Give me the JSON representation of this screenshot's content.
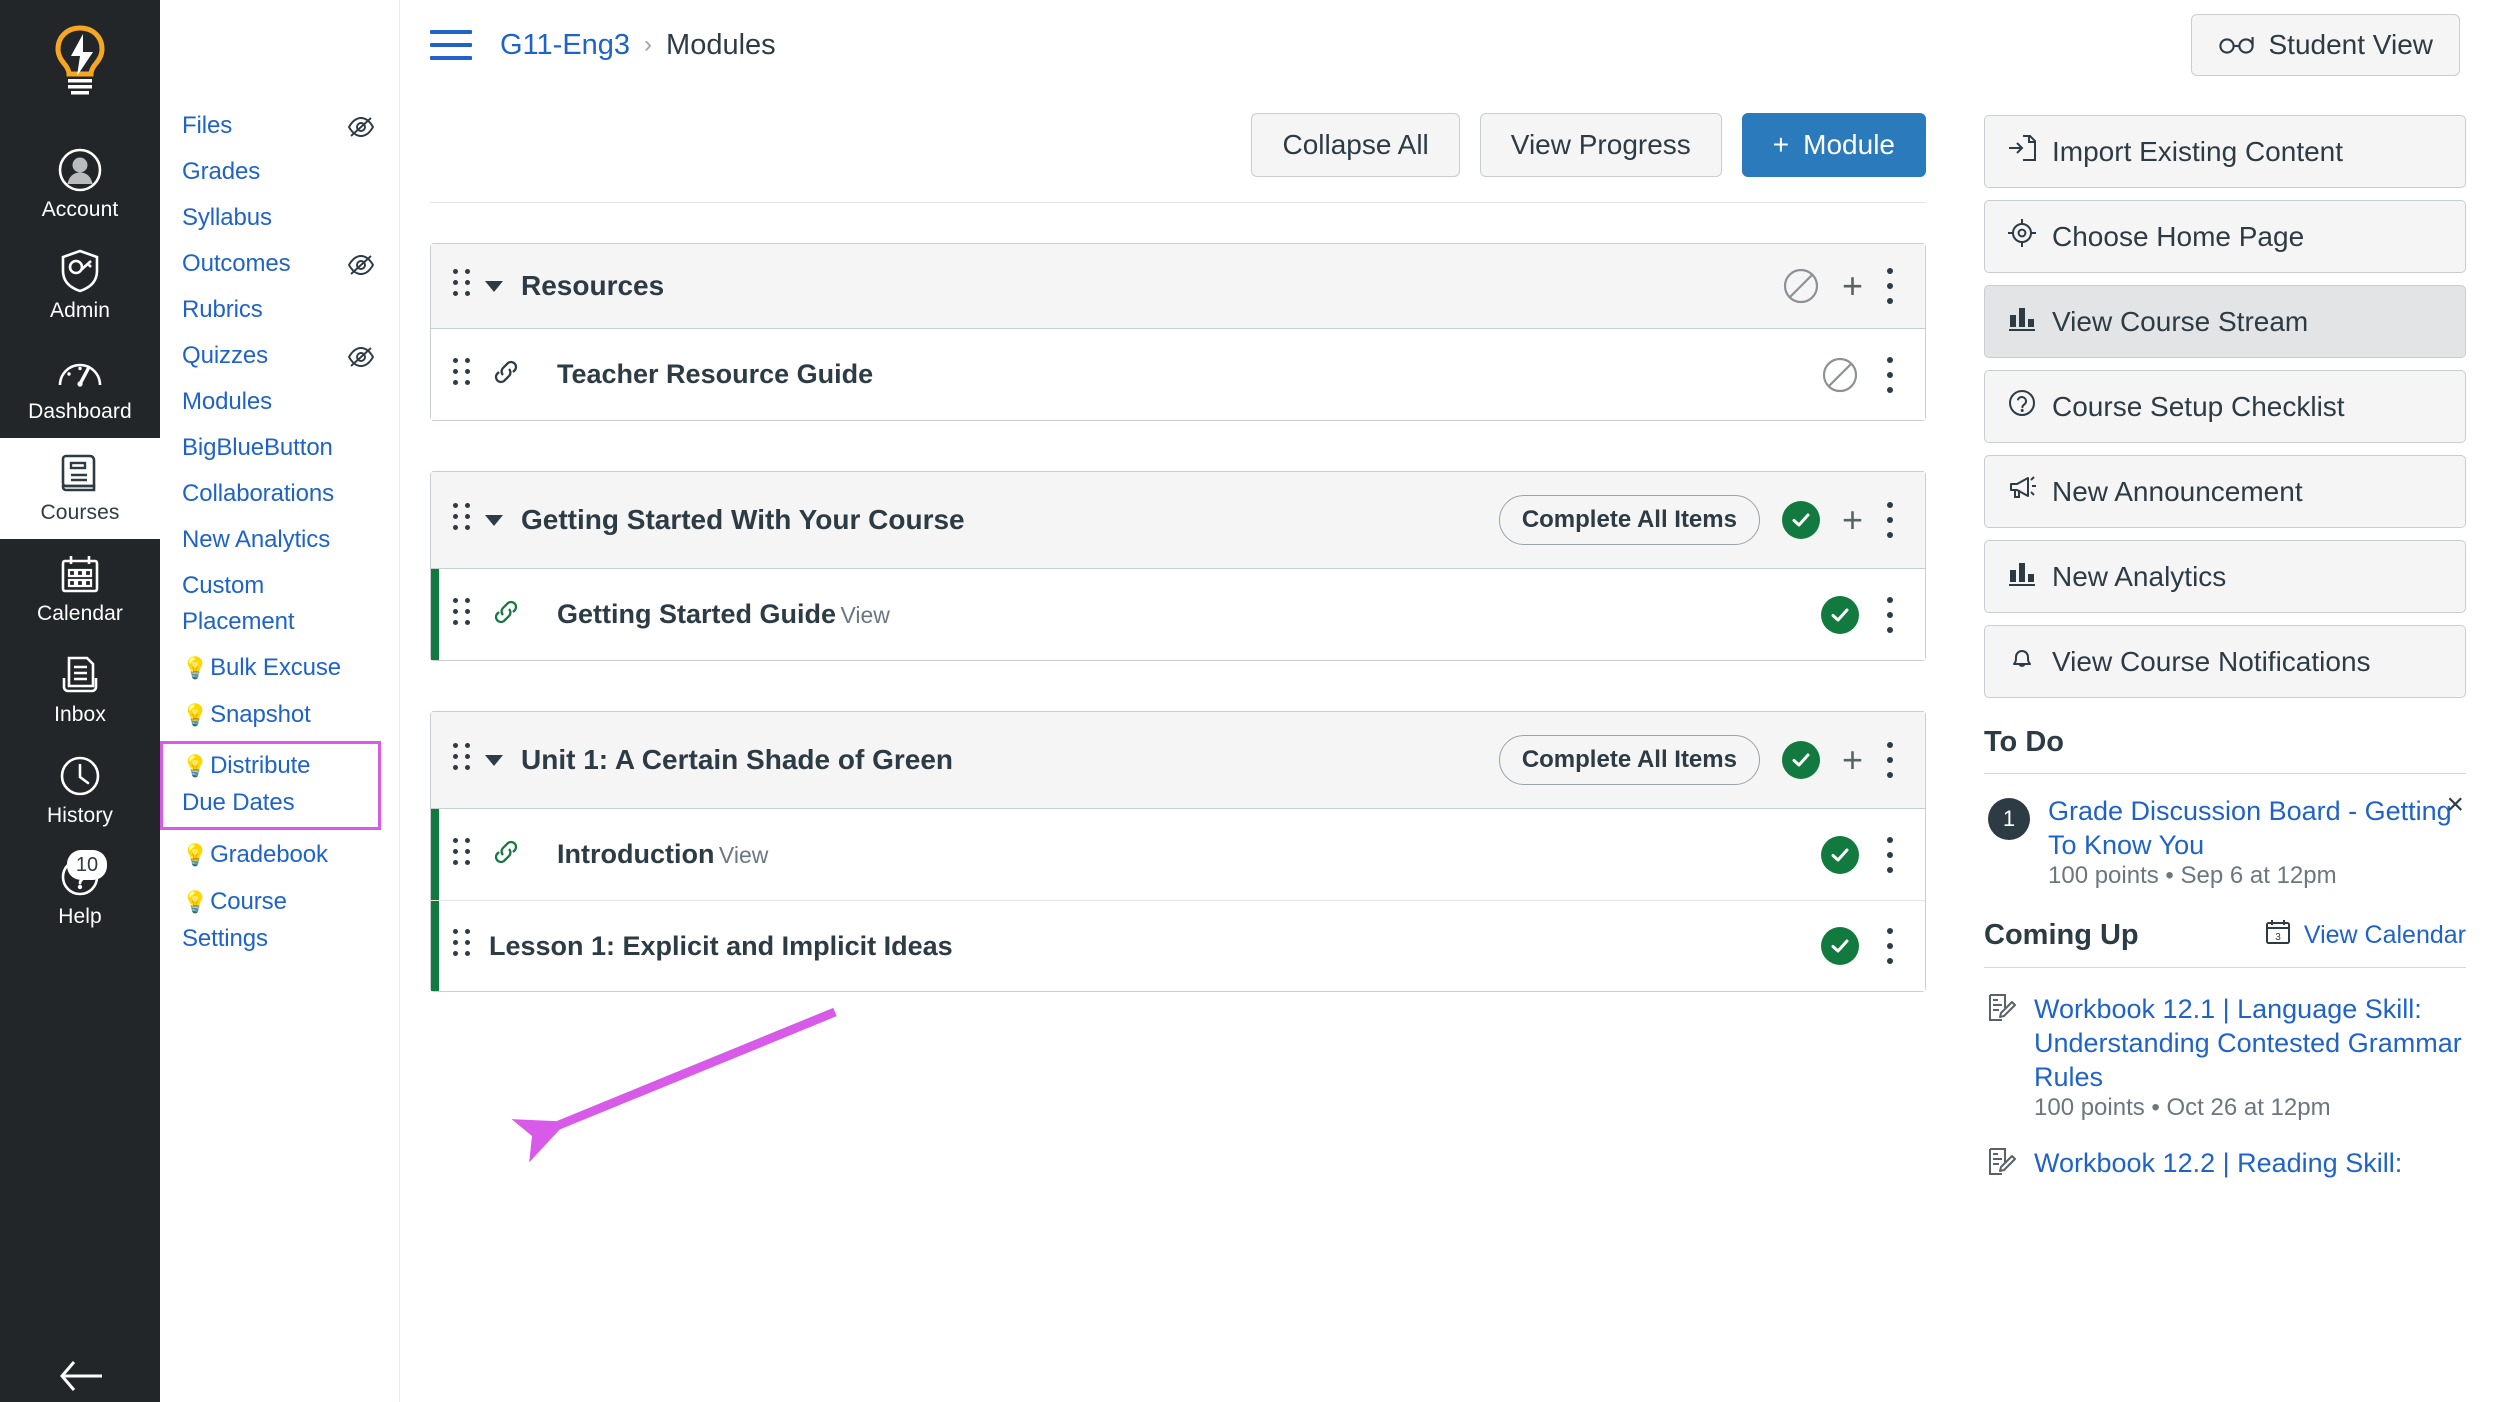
{
  "colors": {
    "brand_blue": "#2B7ABC",
    "link_blue": "#1f63c9",
    "dark_nav": "#222629",
    "published_green": "#127A3E",
    "annotation_magenta": "#d85ae8",
    "text_dark": "#2D3B45"
  },
  "global_nav": {
    "logo_name": "lightbulb-logo",
    "items": [
      {
        "label": "Account",
        "icon": "user-avatar-icon",
        "active": false
      },
      {
        "label": "Admin",
        "icon": "shield-key-icon",
        "active": false
      },
      {
        "label": "Dashboard",
        "icon": "dashboard-gauge-icon",
        "active": false
      },
      {
        "label": "Courses",
        "icon": "book-icon",
        "active": true
      },
      {
        "label": "Calendar",
        "icon": "calendar-icon",
        "active": false
      },
      {
        "label": "Inbox",
        "icon": "inbox-tray-icon",
        "active": false
      },
      {
        "label": "History",
        "icon": "clock-icon",
        "active": false
      },
      {
        "label": "Help",
        "icon": "question-circle-icon",
        "active": false,
        "badge": "10"
      }
    ],
    "collapse_label": "collapse-nav-icon"
  },
  "course_nav": {
    "items": [
      {
        "label": "Files",
        "hidden_icon": true,
        "bulb": false
      },
      {
        "label": "Grades",
        "hidden_icon": false,
        "bulb": false
      },
      {
        "label": "Syllabus",
        "hidden_icon": false,
        "bulb": false
      },
      {
        "label": "Outcomes",
        "hidden_icon": true,
        "bulb": false
      },
      {
        "label": "Rubrics",
        "hidden_icon": false,
        "bulb": false
      },
      {
        "label": "Quizzes",
        "hidden_icon": true,
        "bulb": false
      },
      {
        "label": "Modules",
        "hidden_icon": false,
        "bulb": false
      },
      {
        "label": "BigBlueButton",
        "hidden_icon": false,
        "bulb": false
      },
      {
        "label": "Collaborations",
        "hidden_icon": false,
        "bulb": false
      },
      {
        "label": "New Analytics",
        "hidden_icon": false,
        "bulb": false
      },
      {
        "label": "Custom Placement",
        "hidden_icon": false,
        "bulb": false
      },
      {
        "label": "Bulk Excuse",
        "hidden_icon": false,
        "bulb": true
      },
      {
        "label": "Snapshot",
        "hidden_icon": false,
        "bulb": true
      },
      {
        "label": "Distribute Due Dates",
        "hidden_icon": false,
        "bulb": true,
        "highlighted": true
      },
      {
        "label": "Gradebook",
        "hidden_icon": false,
        "bulb": true
      },
      {
        "label": "Course Settings",
        "hidden_icon": false,
        "bulb": true
      }
    ]
  },
  "header": {
    "menu_icon": "hamburger-menu-icon",
    "breadcrumb_course": "G11-Eng3",
    "breadcrumb_separator": "›",
    "breadcrumb_current": "Modules",
    "student_view_label": "Student View",
    "student_view_icon": "glasses-icon"
  },
  "toolbar": {
    "collapse_all_label": "Collapse All",
    "view_progress_label": "View Progress",
    "add_module_label": "Module",
    "add_module_plus": "+"
  },
  "modules": [
    {
      "title": "Resources",
      "published": false,
      "pill": null,
      "has_plus": true,
      "items": [
        {
          "title": "Teacher Resource Guide",
          "sub": null,
          "published": false,
          "indicator": false,
          "icon": "link-icon"
        }
      ]
    },
    {
      "title": "Getting Started With Your Course",
      "published": true,
      "pill": "Complete All Items",
      "has_plus": true,
      "items": [
        {
          "title": "Getting Started Guide",
          "sub": "View",
          "published": true,
          "indicator": true,
          "icon": "link-icon"
        }
      ]
    },
    {
      "title": "Unit 1: A Certain Shade of Green",
      "published": true,
      "pill": "Complete All Items",
      "has_plus": true,
      "items": [
        {
          "title": "Introduction",
          "sub": "View",
          "published": true,
          "indicator": true,
          "icon": "link-icon"
        },
        {
          "title": "Lesson 1: Explicit and Implicit Ideas",
          "sub": null,
          "published": true,
          "indicator": true,
          "icon": "link-icon"
        }
      ]
    }
  ],
  "sidebar": {
    "buttons": [
      {
        "label": "Import Existing Content",
        "icon": "import-document-icon",
        "active": false
      },
      {
        "label": "Choose Home Page",
        "icon": "target-icon",
        "active": false
      },
      {
        "label": "View Course Stream",
        "icon": "bar-chart-icon",
        "active": true
      },
      {
        "label": "Course Setup Checklist",
        "icon": "question-circle-icon",
        "active": false
      },
      {
        "label": "New Announcement",
        "icon": "megaphone-icon",
        "active": false
      },
      {
        "label": "New Analytics",
        "icon": "bar-chart-icon",
        "active": false
      },
      {
        "label": "View Course Notifications",
        "icon": "bell-icon",
        "active": false
      }
    ],
    "todo": {
      "heading": "To Do",
      "items": [
        {
          "badge": "1",
          "title": "Grade Discussion Board - Getting To Know You",
          "meta": "100 points • Sep 6 at 12pm",
          "dismiss": "×"
        }
      ]
    },
    "coming_up": {
      "heading": "Coming Up",
      "view_calendar_label": "View Calendar",
      "view_calendar_icon": "calendar-icon",
      "items": [
        {
          "icon": "assignment-icon",
          "title": "Workbook 12.1 | Language Skill: Understanding Contested Grammar Rules",
          "meta": "100 points • Oct 26 at 12pm"
        },
        {
          "icon": "assignment-icon",
          "title": "Workbook 12.2 | Reading Skill:",
          "meta": ""
        }
      ]
    }
  },
  "annotation": {
    "type": "arrow-and-box",
    "target": "Distribute Due Dates",
    "color": "#d85ae8"
  }
}
